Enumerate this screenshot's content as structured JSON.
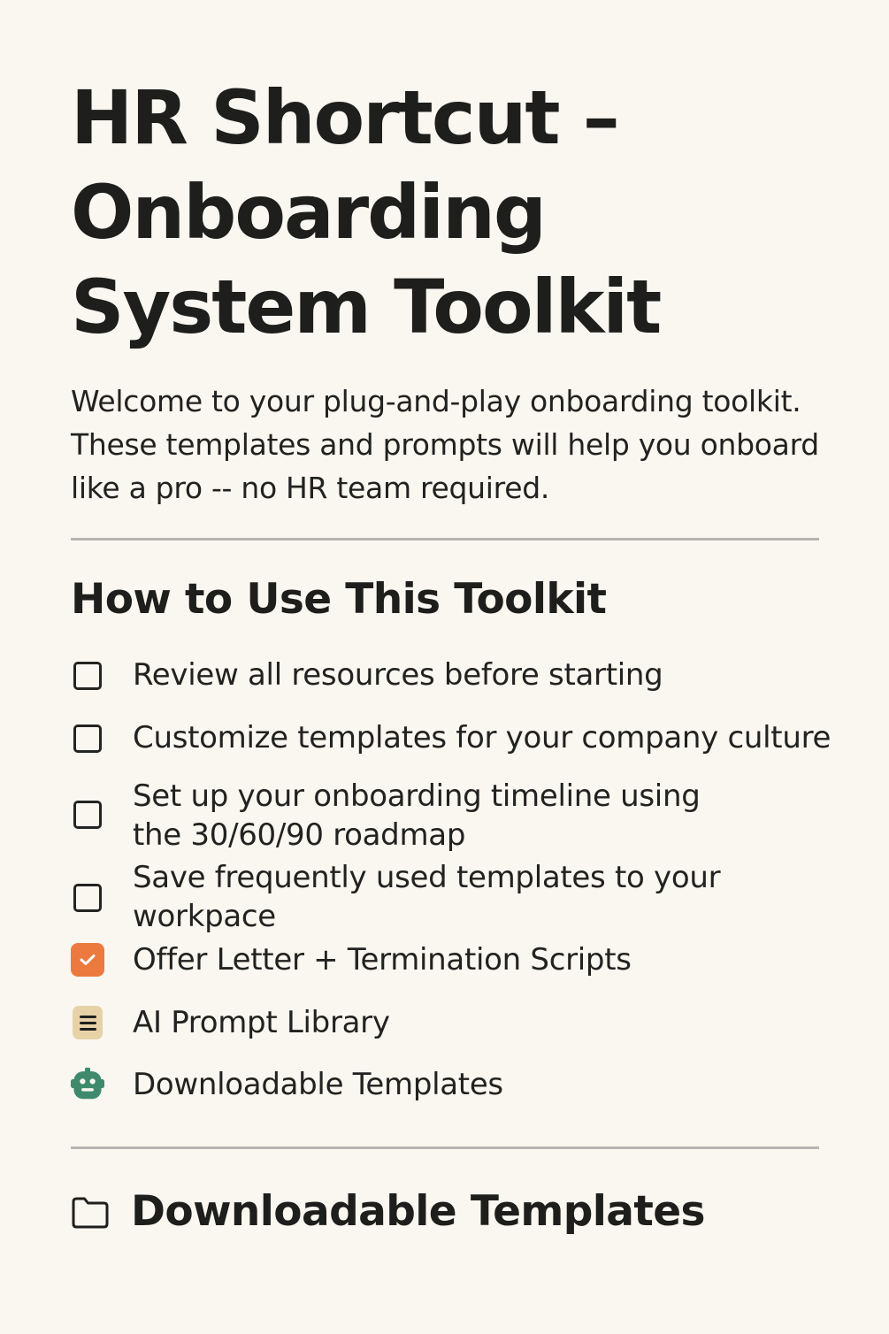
{
  "header": {
    "title": "HR Shortcut – Onboarding System Toolkit",
    "intro": "Welcome to your plug-and-play onboarding toolkit. These templates and prompts will help you onboard like a pro -- no HR team required."
  },
  "how_to_use": {
    "heading": "How to Use This Toolkit",
    "items": [
      {
        "label": "Review all resources before starting",
        "icon": "checkbox-unchecked",
        "checked": false
      },
      {
        "label": "Customize templates for your company culture",
        "icon": "checkbox-unchecked",
        "checked": false
      },
      {
        "label": "Set up your onboarding timeline using the 30/60/90 roadmap",
        "icon": "checkbox-unchecked",
        "checked": false
      },
      {
        "label": "Save frequently used templates to your workpace",
        "icon": "checkbox-unchecked",
        "checked": false
      },
      {
        "label": "Offer Letter + Termination Scripts",
        "icon": "checkbox-checked-icon",
        "checked": true
      },
      {
        "label": "AI Prompt Library",
        "icon": "notepad-icon"
      },
      {
        "label": "Downloadable Templates",
        "icon": "robot-icon"
      }
    ]
  },
  "downloads": {
    "heading": "Downloadable Templates",
    "icon": "folder-icon"
  },
  "colors": {
    "background": "#faf7f1",
    "accent_orange": "#ec7a3f",
    "note_tan": "#e7d2a8",
    "robot_green": "#3f8a6d",
    "divider": "#b6b5b1"
  }
}
